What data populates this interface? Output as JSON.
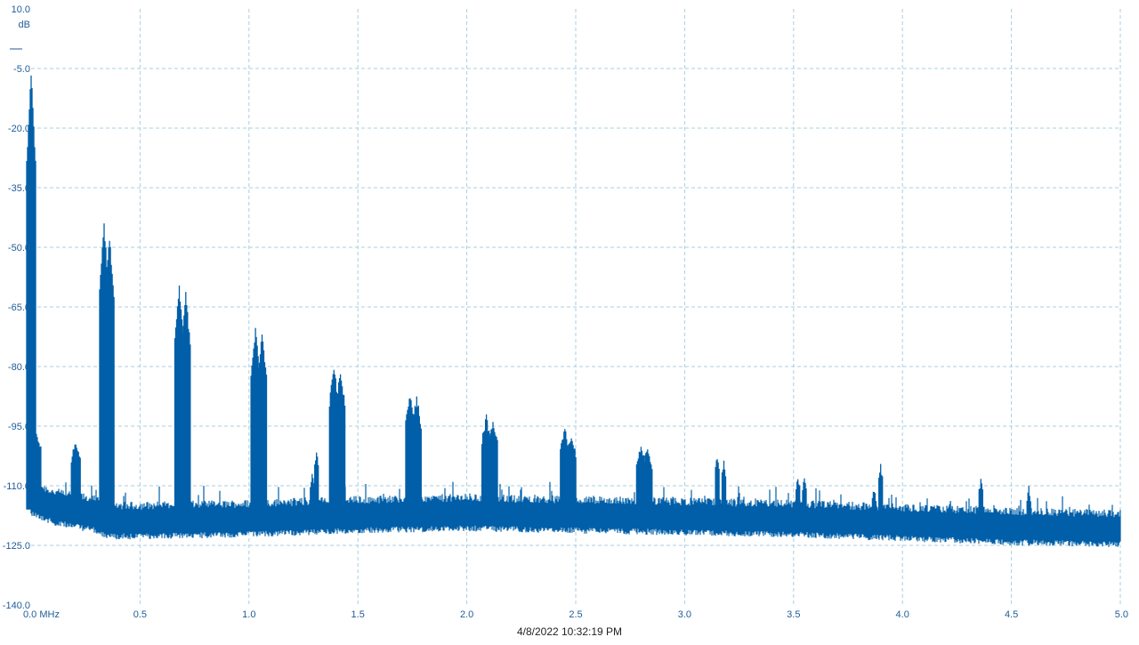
{
  "chart_data": {
    "type": "line",
    "title": "",
    "xlabel": "",
    "ylabel": "dB",
    "x_unit": "MHz",
    "xlim": [
      0.0,
      5.0
    ],
    "ylim": [
      -140.0,
      10.0
    ],
    "x_ticks": [
      "0.0 MHz",
      "0.5",
      "1.0",
      "1.5",
      "2.0",
      "2.5",
      "3.0",
      "3.5",
      "4.0",
      "4.5",
      "5.0"
    ],
    "y_ticks": [
      "10.0",
      "-5.0",
      "-20.0",
      "-35.0",
      "-50.0",
      "-65.0",
      "-80.0",
      "-95.0",
      "-110.0",
      "-125.0",
      "-140.0"
    ],
    "grid": true,
    "legend": "none",
    "timestamp": "4/8/2022 10:32:19 PM",
    "series": [
      {
        "color": "#005fa8",
        "noise_floor": [
          [
            0.0,
            -113.0
          ],
          [
            0.1,
            -115.5
          ],
          [
            0.2,
            -116.5
          ],
          [
            0.3,
            -117.5
          ],
          [
            0.35,
            -119.0
          ],
          [
            0.5,
            -119.0
          ],
          [
            1.0,
            -118.5
          ],
          [
            1.5,
            -117.5
          ],
          [
            2.0,
            -117.0
          ],
          [
            2.5,
            -117.5
          ],
          [
            3.0,
            -118.0
          ],
          [
            3.5,
            -118.5
          ],
          [
            4.0,
            -119.5
          ],
          [
            4.5,
            -120.5
          ],
          [
            5.0,
            -121.0
          ]
        ],
        "noise_spread_db": 6,
        "peaks": [
          {
            "x": 0.0,
            "y": -5.0
          },
          {
            "x": 0.024,
            "y": -95.5
          },
          {
            "x": 0.205,
            "y": -98.0
          },
          {
            "x": 0.335,
            "y": -43.5
          },
          {
            "x": 0.36,
            "y": -46.5
          },
          {
            "x": 0.68,
            "y": -59.5
          },
          {
            "x": 0.71,
            "y": -61.0
          },
          {
            "x": 1.03,
            "y": -70.0
          },
          {
            "x": 1.06,
            "y": -71.5
          },
          {
            "x": 1.29,
            "y": -106.5
          },
          {
            "x": 1.31,
            "y": -101.0
          },
          {
            "x": 1.39,
            "y": -79.5
          },
          {
            "x": 1.42,
            "y": -80.0
          },
          {
            "x": 1.74,
            "y": -86.0
          },
          {
            "x": 1.77,
            "y": -87.0
          },
          {
            "x": 2.09,
            "y": -92.0
          },
          {
            "x": 2.12,
            "y": -92.5
          },
          {
            "x": 2.45,
            "y": -95.0
          },
          {
            "x": 2.48,
            "y": -96.5
          },
          {
            "x": 2.8,
            "y": -99.0
          },
          {
            "x": 2.83,
            "y": -99.5
          },
          {
            "x": 3.15,
            "y": -102.0
          },
          {
            "x": 3.18,
            "y": -103.0
          },
          {
            "x": 3.52,
            "y": -106.5
          },
          {
            "x": 3.55,
            "y": -107.0
          },
          {
            "x": 3.87,
            "y": -110.5
          },
          {
            "x": 3.9,
            "y": -104.5
          },
          {
            "x": 4.22,
            "y": -113.0
          },
          {
            "x": 4.36,
            "y": -108.0
          },
          {
            "x": 4.58,
            "y": -110.0
          }
        ]
      }
    ]
  }
}
